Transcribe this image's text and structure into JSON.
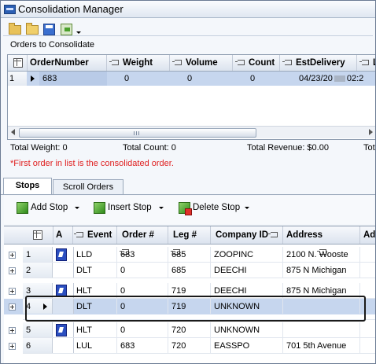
{
  "window": {
    "title": "Consolidation Manager"
  },
  "toolbar": {
    "icons": [
      "new-folder-icon",
      "open-folder-icon",
      "save-icon",
      "export-icon",
      "dropdown-arrow-icon"
    ]
  },
  "orders_section": {
    "label": "Orders to Consolidate"
  },
  "orders_grid": {
    "columns": [
      "OrderNumber",
      "Weight",
      "Volume",
      "Count",
      "EstDelivery",
      "La"
    ],
    "rows": [
      {
        "num": "1",
        "order_number": "683",
        "weight": "0",
        "volume": "0",
        "count": "0",
        "est_delivery": "04/23/20",
        "est_time": "02:2"
      }
    ]
  },
  "totals": {
    "weight": "Total Weight: 0",
    "count": "Total Count: 0",
    "revenue": "Total Revenue: $0.00",
    "more": "Tot"
  },
  "warning": "*First order in list is the consolidated order.",
  "tabs": [
    {
      "label": "Stops"
    },
    {
      "label": "Scroll Orders"
    }
  ],
  "stop_buttons": {
    "add": "Add Stop",
    "insert": "Insert Stop",
    "delete": "Delete Stop"
  },
  "stops_grid": {
    "columns": [
      "A",
      "Event",
      "Order #",
      "Leg #",
      "Company ID",
      "Address",
      "Ad"
    ],
    "rows": [
      {
        "num": "1",
        "event": "LLD",
        "order": "683",
        "leg": "685",
        "company": "ZOOPINC",
        "address": "2100 N. Wooste"
      },
      {
        "num": "2",
        "event": "DLT",
        "order": "0",
        "leg": "685",
        "company": "DEECHI",
        "address": "875 N Michigan"
      },
      {
        "num": "3",
        "event": "HLT",
        "order": "0",
        "leg": "719",
        "company": "DEECHI",
        "address": "875 N Michigan"
      },
      {
        "num": "4",
        "event": "DLT",
        "order": "0",
        "leg": "719",
        "company": "UNKNOWN",
        "address": ""
      },
      {
        "num": "5",
        "event": "HLT",
        "order": "0",
        "leg": "720",
        "company": "UNKNOWN",
        "address": ""
      },
      {
        "num": "6",
        "event": "LUL",
        "order": "683",
        "leg": "720",
        "company": "EASSPO",
        "address": "701 5th Avenue"
      }
    ]
  }
}
